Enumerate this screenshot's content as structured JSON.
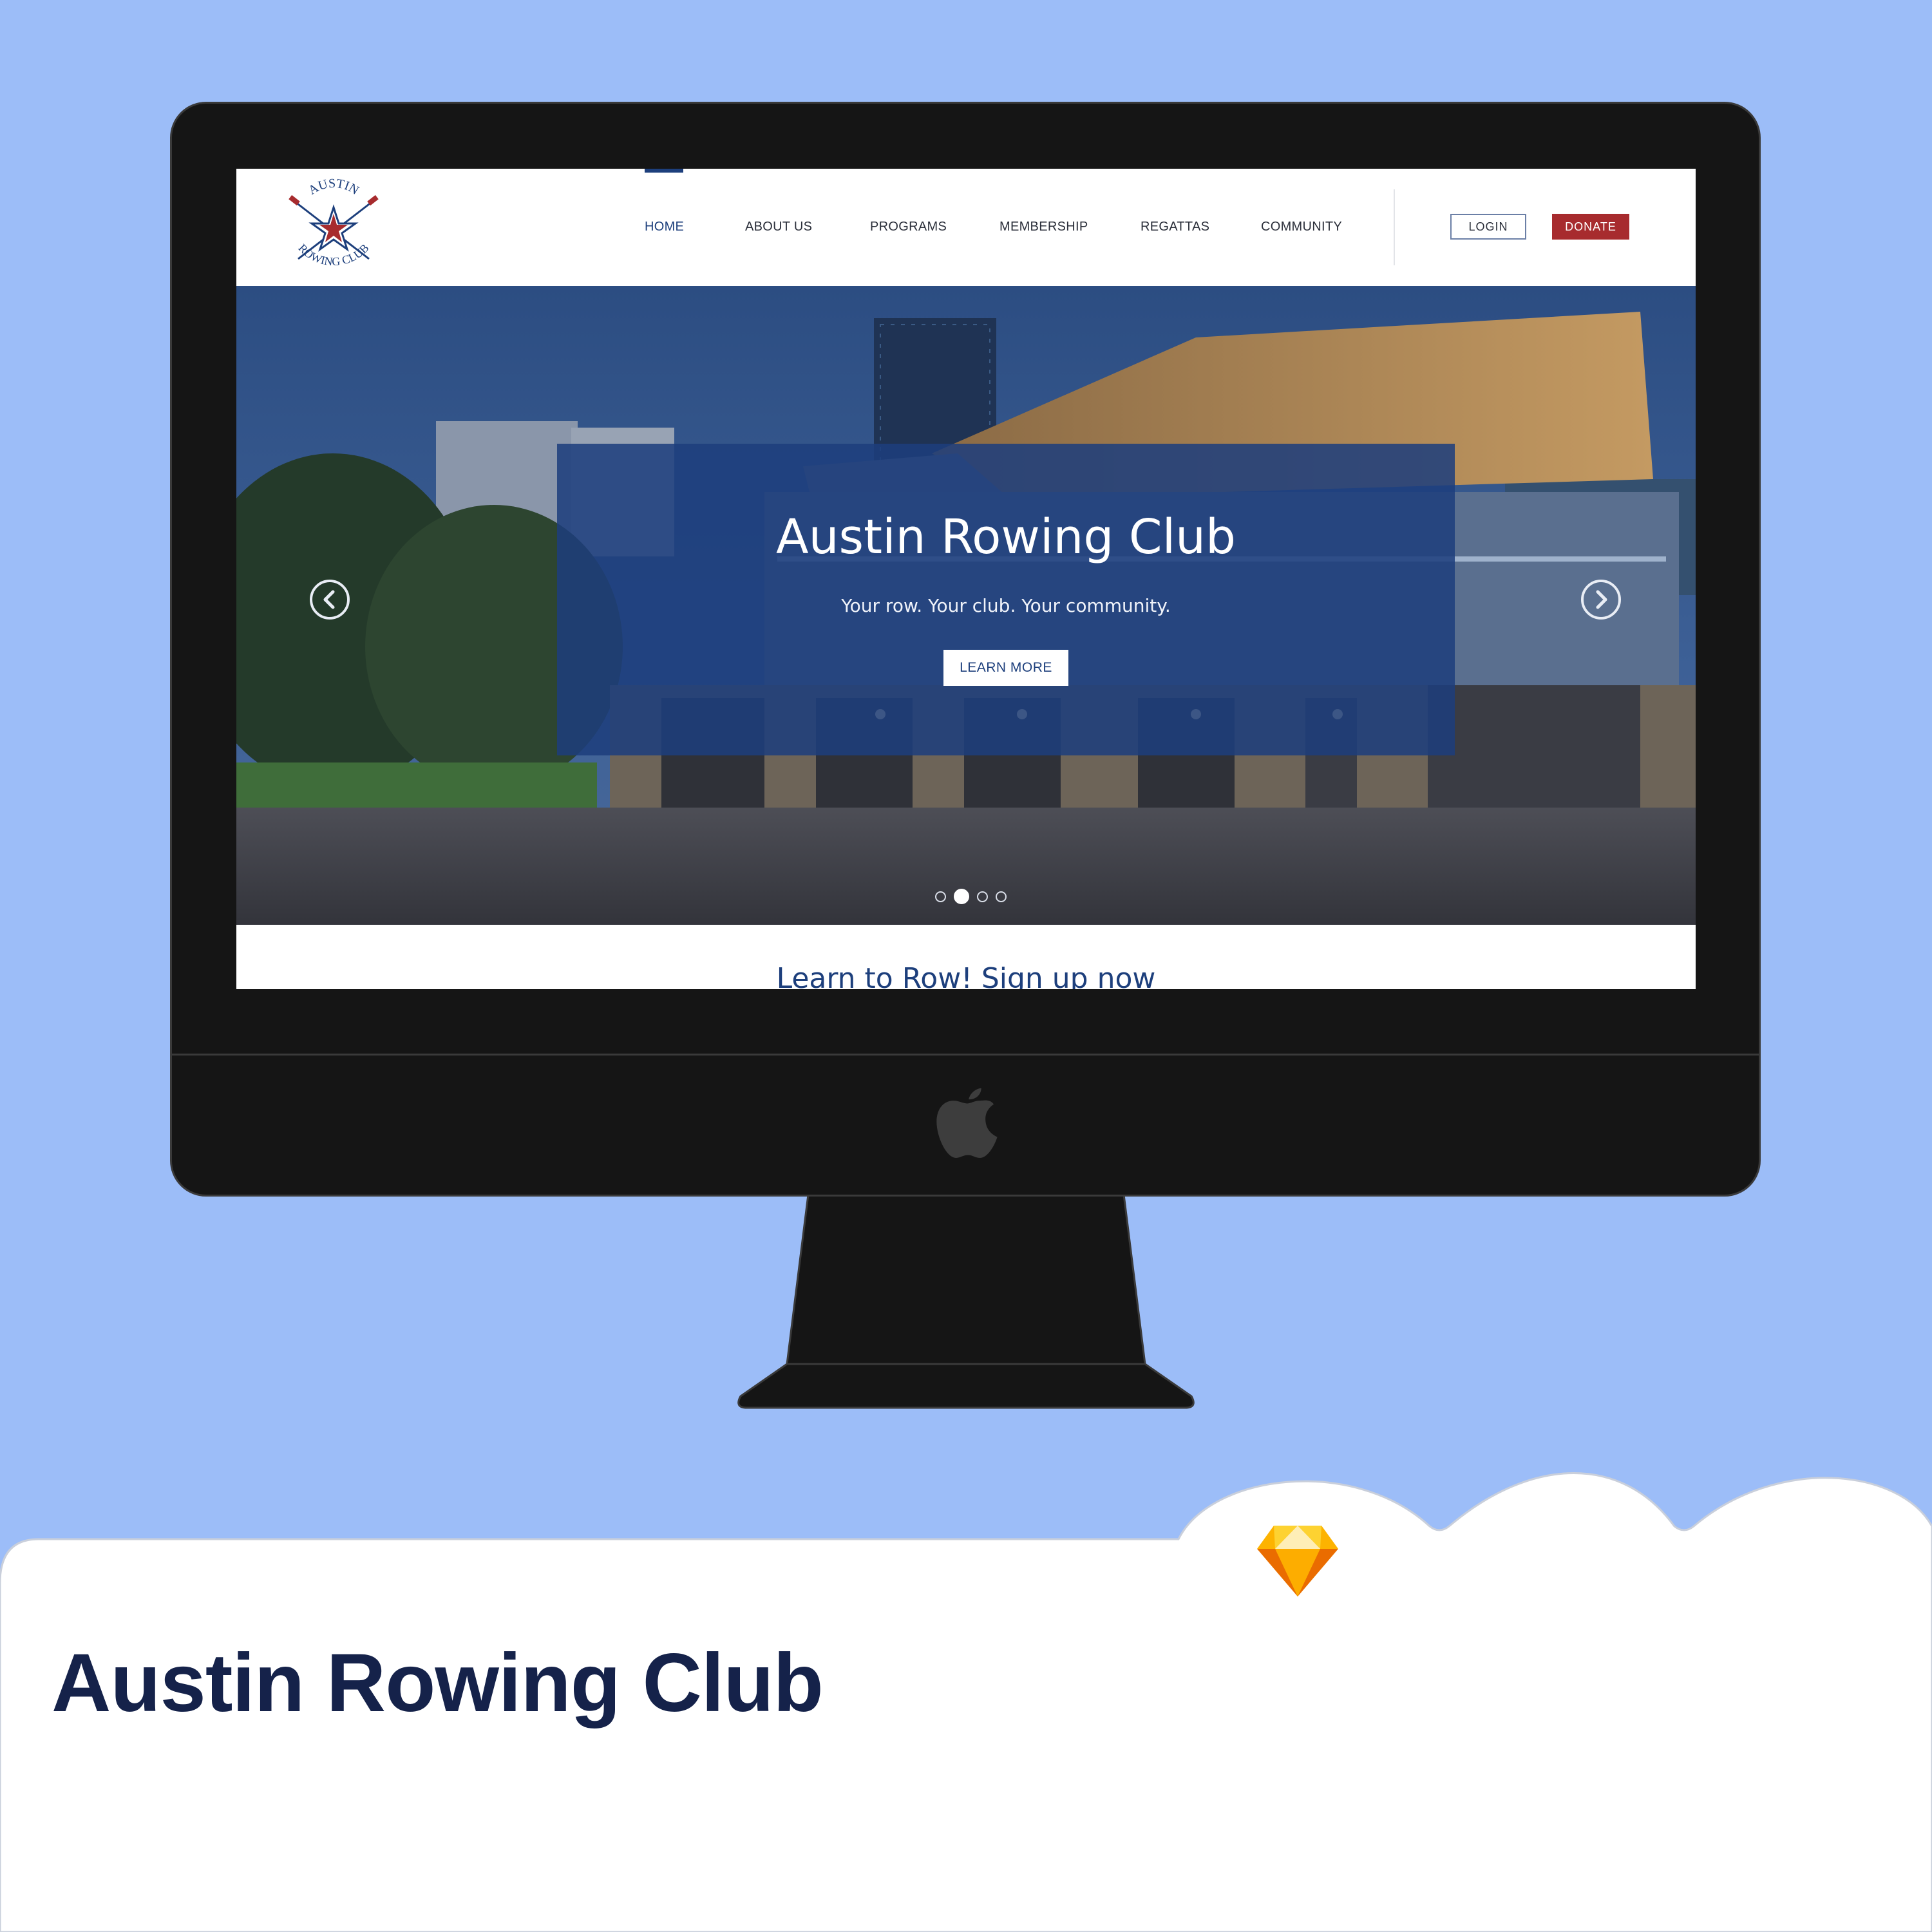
{
  "colors": {
    "background": "#9cbdf8",
    "navy": "#1d3f7c",
    "donate_red": "#a72b2e",
    "title_dark": "#15224a"
  },
  "site": {
    "logo": {
      "icon": "austin-rowing-club-star-oars-logo",
      "top_text": "AUSTIN",
      "bottom_text": "ROWING CLUB"
    },
    "nav": {
      "items": [
        {
          "label": "HOME",
          "active": true
        },
        {
          "label": "ABOUT US"
        },
        {
          "label": "PROGRAMS"
        },
        {
          "label": "MEMBERSHIP"
        },
        {
          "label": "REGATTAS"
        },
        {
          "label": "COMMUNITY"
        }
      ],
      "login_label": "LOGIN",
      "donate_label": "DONATE"
    },
    "hero": {
      "title": "Austin Rowing Club",
      "subtitle": "Your row. Your club. Your community.",
      "button_label": "LEARN MORE",
      "prev_icon": "chevron-left-circle-icon",
      "next_icon": "chevron-right-circle-icon",
      "slides_total": 4,
      "active_slide": 2
    },
    "teaser": "Learn to Row! Sign up now"
  },
  "card": {
    "title": "Austin Rowing Club",
    "badge_icon": "sketch-diamond-icon"
  }
}
